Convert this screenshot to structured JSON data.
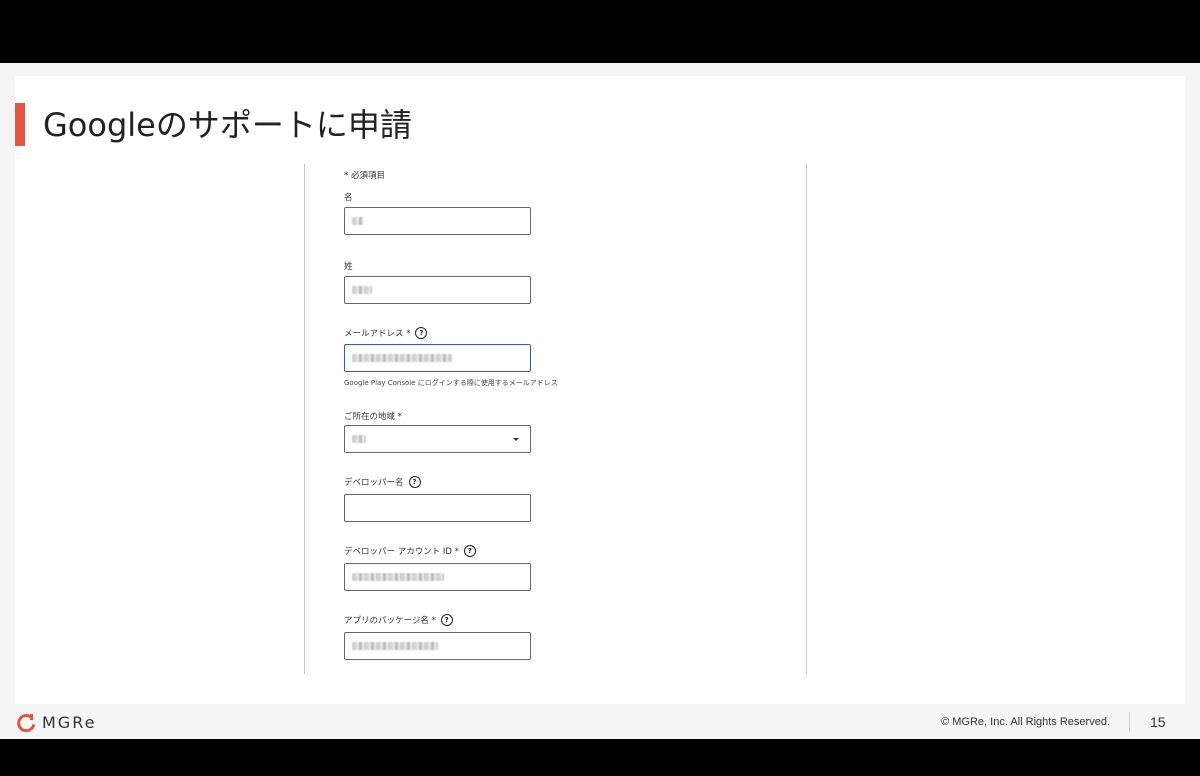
{
  "slide": {
    "title": "Googleのサポートに申請",
    "accent_color": "#e2583e"
  },
  "form": {
    "required_note": "* 必須項目",
    "first_name": {
      "label": "名"
    },
    "last_name": {
      "label": "姓"
    },
    "email": {
      "label": "メールアドレス *",
      "helper": "Google Play Console にログインする際に使用するメールアドレス"
    },
    "region": {
      "label": "ご所在の地域 *"
    },
    "developer_name": {
      "label": "デベロッパー名"
    },
    "developer_account_id": {
      "label": "デベロッパー アカウント ID *"
    },
    "package_name": {
      "label": "アプリのパッケージ名 *"
    },
    "help_icon": "?"
  },
  "footer": {
    "logo_text": "MGRe",
    "copyright": "© MGRe, Inc. All Rights Reserved.",
    "page_number": "15"
  }
}
